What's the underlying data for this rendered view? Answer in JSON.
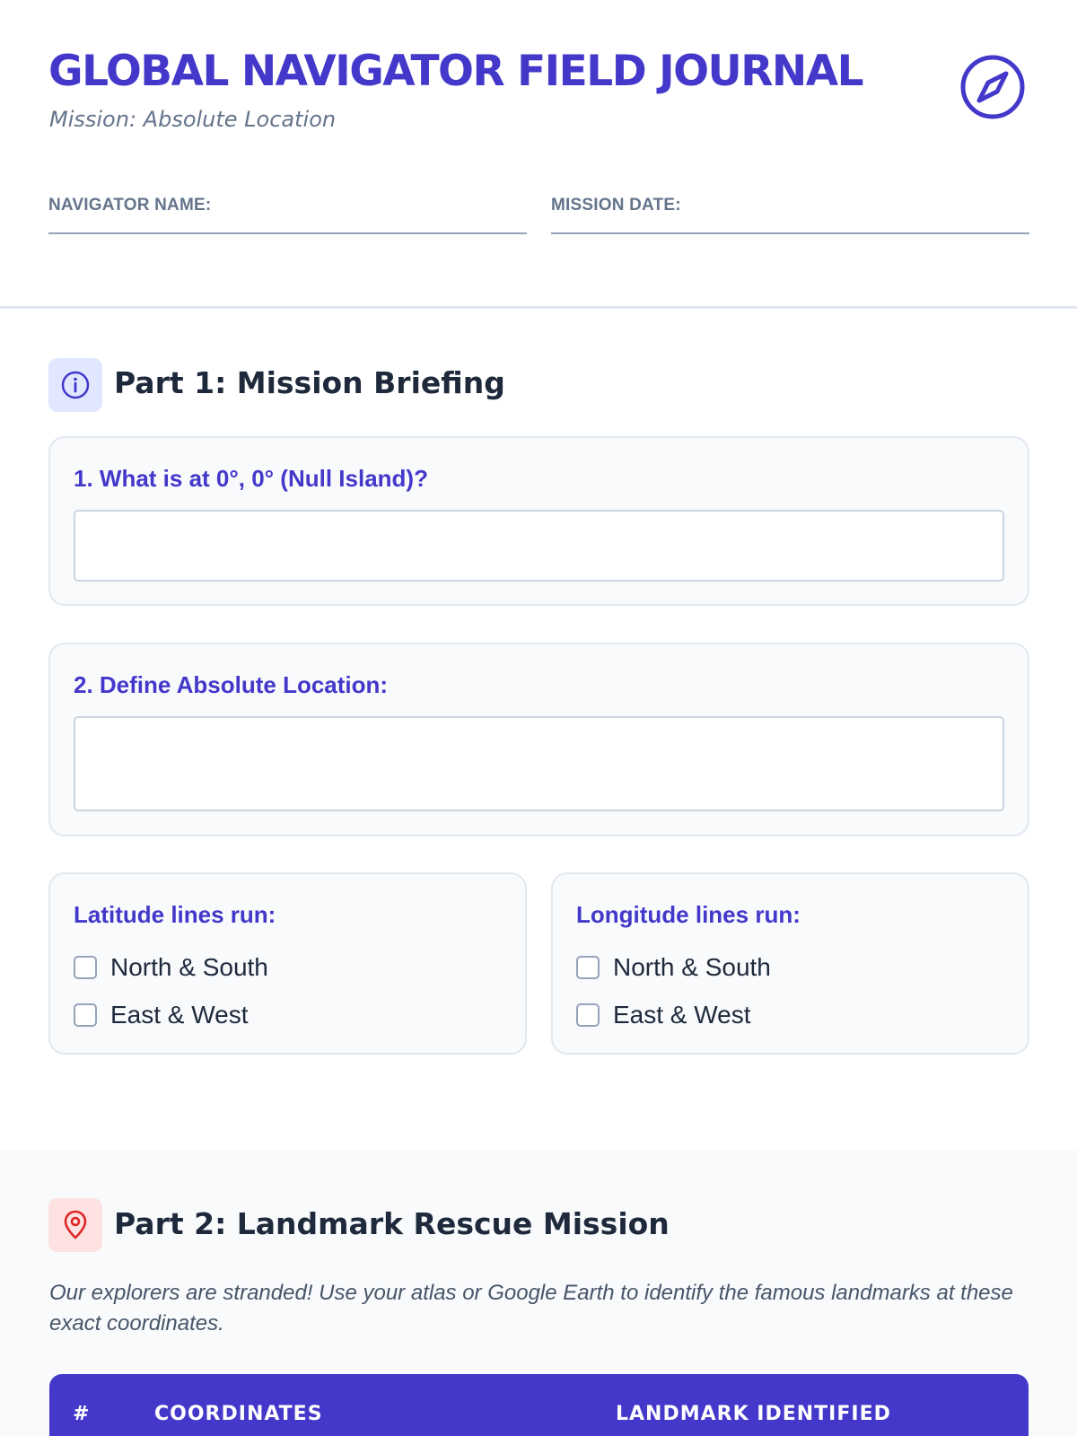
{
  "header": {
    "title": "GLOBAL NAVIGATOR FIELD JOURNAL",
    "subtitle": "Mission: Absolute Location",
    "fields": {
      "navigator_name_label": "NAVIGATOR NAME:",
      "navigator_name_value": "",
      "mission_date_label": "MISSION DATE:",
      "mission_date_value": ""
    },
    "icon": "compass-icon"
  },
  "part1": {
    "title": "Part 1: Mission Briefing",
    "icon": "info-icon",
    "q1": {
      "label": "1. What is at 0°, 0° (Null Island)?",
      "value": ""
    },
    "q2": {
      "label": "2. Define Absolute Location:",
      "value": ""
    },
    "latitude": {
      "label": "Latitude lines run:",
      "options": [
        "North & South",
        "East & West"
      ]
    },
    "longitude": {
      "label": "Longitude lines run:",
      "options": [
        "North & South",
        "East & West"
      ]
    }
  },
  "part2": {
    "title": "Part 2: Landmark Rescue Mission",
    "icon": "map-pin-icon",
    "description": "Our explorers are stranded! Use your atlas or Google Earth to identify the famous landmarks at these exact coordinates.",
    "table_headers": [
      "#",
      "COORDINATES",
      "LANDMARK IDENTIFIED"
    ]
  },
  "colors": {
    "accent": "#4338ca",
    "muted": "#64748b",
    "card_bg": "#f8fafc",
    "info_icon_bg": "#e0e7ff",
    "pin_icon_bg": "#fee2e2",
    "pin_icon": "#dc2626"
  }
}
